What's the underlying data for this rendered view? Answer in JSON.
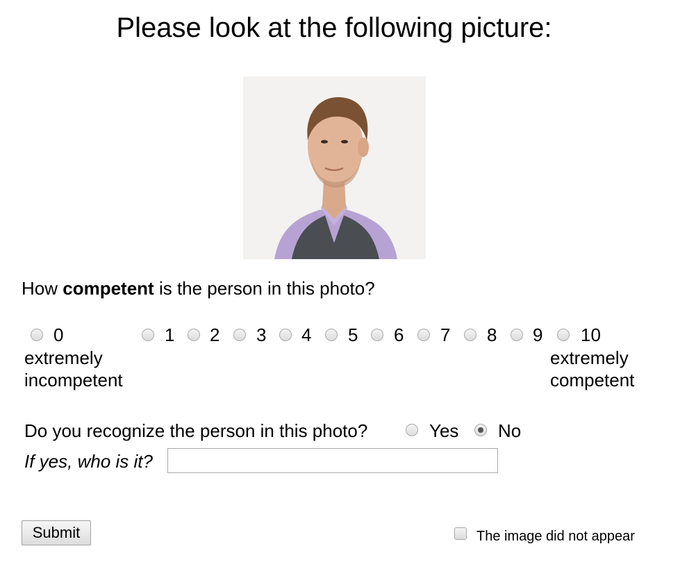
{
  "page": {
    "heading": "Please look at the following picture:",
    "photo_alt": "portrait photo of a man"
  },
  "rating": {
    "question_prefix": "How ",
    "question_bold": "competent",
    "question_suffix": " is the person in this photo?",
    "scale": [
      "0",
      "1",
      "2",
      "3",
      "4",
      "5",
      "6",
      "7",
      "8",
      "9",
      "10"
    ],
    "selected": null,
    "low_anchor_line1": "extremely",
    "low_anchor_line2": "incompetent",
    "high_anchor_line1": "extremely",
    "high_anchor_line2": "competent"
  },
  "recognition": {
    "question": "Do you recognize the person in this photo?",
    "yes_label": "Yes",
    "no_label": "No",
    "selected": "No",
    "who_label": "If yes, who is it?",
    "who_value": ""
  },
  "footer": {
    "submit_label": "Submit",
    "image_missing_label": "The image did not appear",
    "image_missing_checked": false
  }
}
